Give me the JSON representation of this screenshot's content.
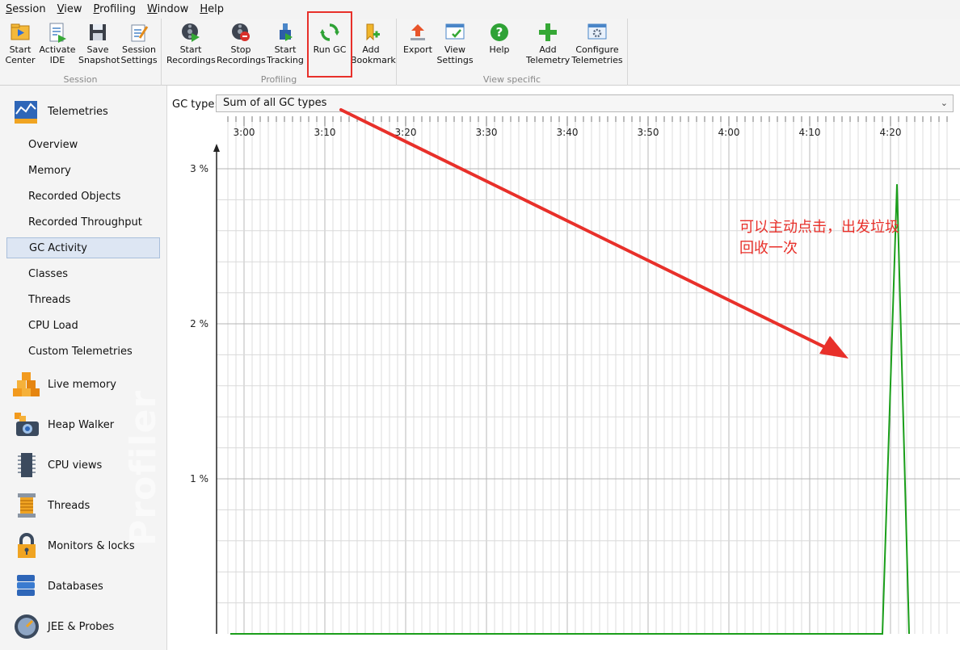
{
  "menu": [
    {
      "underline": "S",
      "rest": "ession"
    },
    {
      "underline": "V",
      "rest": "iew"
    },
    {
      "underline": "P",
      "rest": "rofiling"
    },
    {
      "underline": "W",
      "rest": "indow"
    },
    {
      "underline": "H",
      "rest": "elp"
    }
  ],
  "toolbar": {
    "groups": {
      "session": "Session",
      "profiling": "Profiling",
      "view_specific": "View specific"
    },
    "buttons": {
      "start_center": "Start\nCenter",
      "activate_ide": "Activate\nIDE",
      "save_snapshot": "Save\nSnapshot",
      "session_settings": "Session\nSettings",
      "start_recordings": "Start\nRecordings",
      "stop_recordings": "Stop\nRecordings",
      "start_tracking": "Start\nTracking",
      "run_gc": "Run GC",
      "add_bookmark": "Add\nBookmark",
      "export": "Export",
      "view_settings": "View\nSettings",
      "help": "Help",
      "add_telemetry": "Add\nTelemetry",
      "configure_telemetries": "Configure\nTelemetries"
    }
  },
  "sidebar": {
    "telemetries": "Telemetries",
    "sub_items": [
      "Overview",
      "Memory",
      "Recorded Objects",
      "Recorded Throughput",
      "GC Activity",
      "Classes",
      "Threads",
      "CPU Load",
      "Custom Telemetries"
    ],
    "selected": "GC Activity",
    "categories": [
      "Live memory",
      "Heap Walker",
      "CPU views",
      "Threads",
      "Monitors & locks",
      "Databases",
      "JEE & Probes"
    ],
    "watermark": "Profiler"
  },
  "content": {
    "gc_type_label": "GC type:",
    "gc_type_value": "Sum of all GC types"
  },
  "annotation": {
    "line1": "可以主动点击，出发垃圾",
    "line2": "回收一次",
    "color": "#e8302a"
  },
  "chart_data": {
    "type": "line",
    "title": "",
    "xlabel": "",
    "ylabel": "",
    "x_ticks": [
      "3:00",
      "3:10",
      "3:20",
      "3:30",
      "3:40",
      "3:50",
      "4:00",
      "4:10",
      "4:20"
    ],
    "y_ticks": [
      "1 %",
      "2 %",
      "3 %"
    ],
    "ylim": [
      0,
      3.3
    ],
    "xlim_seconds": [
      175,
      267
    ],
    "grid": true,
    "series": [
      {
        "color": "#1a9e1a",
        "x_seconds": [
          175,
          259,
          260.8,
          262.3
        ],
        "values": [
          0,
          0,
          2.9,
          0
        ]
      }
    ]
  }
}
